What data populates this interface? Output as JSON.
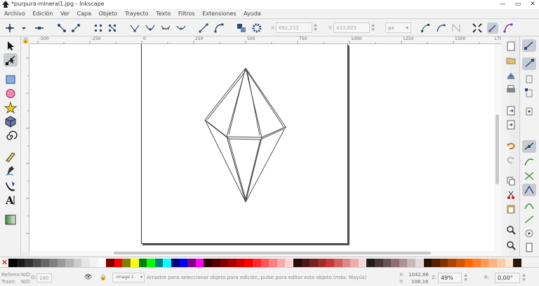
{
  "window": {
    "title": "*purpura-mineral1.jpg - Inkscape",
    "minimize": "—",
    "maximize": "▭",
    "close": "✕"
  },
  "menu": [
    "Archivo",
    "Edición",
    "Ver",
    "Capa",
    "Objeto",
    "Trayecto",
    "Texto",
    "Filtros",
    "Extensiones",
    "Ayuda"
  ],
  "tool_controls": {
    "x_label": "X:",
    "x_value": "692,232",
    "y_label": "Y:",
    "y_value": "433,825",
    "unit": "px"
  },
  "ruler": {
    "h_labels": [
      "-500",
      "-250",
      "0",
      "250",
      "500",
      "750",
      "1000",
      "1250",
      "1500",
      "1750"
    ]
  },
  "status": {
    "fill_label": "Relleno:",
    "fill_value": "N/D",
    "stroke_label": "Trazo:",
    "stroke_value": "N/D",
    "opacity_label": "O:",
    "opacity_value": "100",
    "layer": "-Image 1",
    "message": "Arrastre para seleccionar objeto para edición, pulse para editar este objeto (más: Mayús)",
    "cursor_x_label": "X:",
    "cursor_x": "1042,86",
    "cursor_y_label": "Y:",
    "cursor_y": "108,16",
    "zoom_label": "Z:",
    "zoom": "49%",
    "rotation_label": "R:",
    "rotation": "0,00°"
  },
  "palette_colors": [
    "#000000",
    "#1a1a1a",
    "#333333",
    "#4d4d4d",
    "#666666",
    "#808080",
    "#999999",
    "#b3b3b3",
    "#cccccc",
    "#e6e6e6",
    "#f2f2f2",
    "#ffffff",
    "#800000",
    "#ff0000",
    "#808000",
    "#ffff00",
    "#008000",
    "#00ff00",
    "#008080",
    "#00ffff",
    "#000080",
    "#0000ff",
    "#800080",
    "#ff00ff",
    "#2b0000",
    "#550000",
    "#800000",
    "#aa0000",
    "#d40000",
    "#ff0000",
    "#ff2a2a",
    "#ff5555",
    "#ff8080",
    "#ffaaaa",
    "#ffd5d5",
    "#280b0b",
    "#501616",
    "#782121",
    "#a02c2c",
    "#c83737",
    "#d35f5f",
    "#de8787",
    "#e9afaf",
    "#f4d7d7",
    "#241c1c",
    "#483737",
    "#6c5353",
    "#916f6f",
    "#ac9393",
    "#c8b7b7",
    "#e3dbdb",
    "#2b1100",
    "#552200",
    "#803300",
    "#aa4400",
    "#d45500",
    "#ff6600",
    "#ff7f2a",
    "#ff9955",
    "#ffb380",
    "#ffccaa",
    "#ffe6d5",
    "#28170b"
  ]
}
